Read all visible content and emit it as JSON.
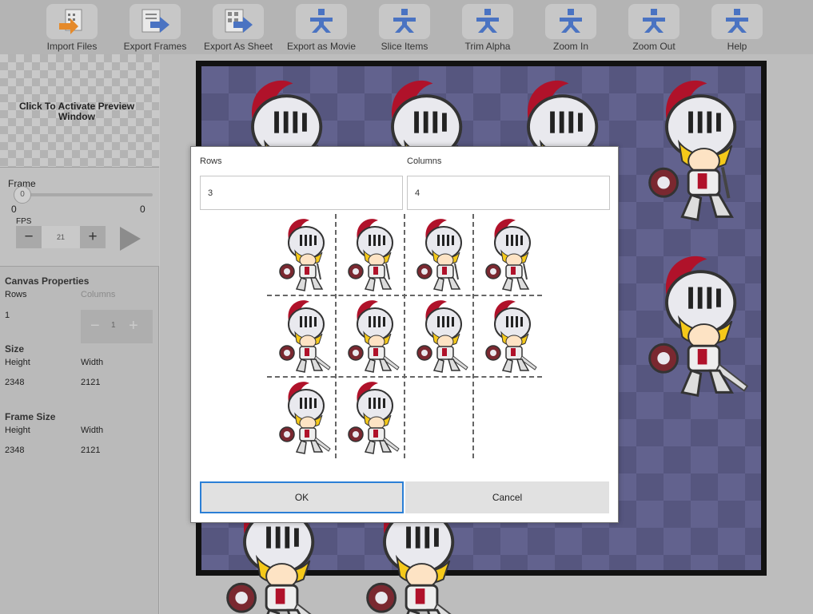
{
  "toolbar": {
    "buttons": [
      {
        "label": "Import Files",
        "icon": "import-files-icon"
      },
      {
        "label": "Export Frames",
        "icon": "export-frames-icon"
      },
      {
        "label": "Export As Sheet",
        "icon": "export-sheet-icon"
      },
      {
        "label": "Export as Movie",
        "icon": "export-movie-icon"
      },
      {
        "label": "Slice Items",
        "icon": "slice-items-icon"
      },
      {
        "label": "Trim Alpha",
        "icon": "trim-alpha-icon"
      },
      {
        "label": "Zoom In",
        "icon": "zoom-in-icon"
      },
      {
        "label": "Zoom Out",
        "icon": "zoom-out-icon"
      },
      {
        "label": "Help",
        "icon": "help-icon"
      }
    ]
  },
  "left_panel": {
    "preview_text": "Click To Activate Preview Window",
    "frame": {
      "label": "Frame",
      "slider_value": "0",
      "min": "0",
      "max": "0",
      "fps_label": "FPS",
      "fps_value": "21",
      "minus": "−",
      "plus": "+"
    },
    "canvas_properties": {
      "title": "Canvas Properties",
      "rows_label": "Rows",
      "columns_label": "Columns",
      "rows_value": "1",
      "columns_value": "1",
      "size_title": "Size",
      "height_label": "Height",
      "width_label": "Width",
      "height_value": "2348",
      "width_value": "2121",
      "frame_size_title": "Frame Size",
      "frame_height_label": "Height",
      "frame_width_label": "Width",
      "frame_height_value": "2348",
      "frame_width_value": "2121"
    }
  },
  "dialog": {
    "rows_label": "Rows",
    "columns_label": "Columns",
    "rows_value": "3",
    "columns_value": "4",
    "grid_rows": 3,
    "grid_cols": 4,
    "filled_cells": 10,
    "ok_label": "OK",
    "cancel_label": "Cancel"
  },
  "colors": {
    "accent": "#2b7fd6",
    "knight_plume": "#b0122a",
    "knight_hair": "#f5c91a"
  }
}
